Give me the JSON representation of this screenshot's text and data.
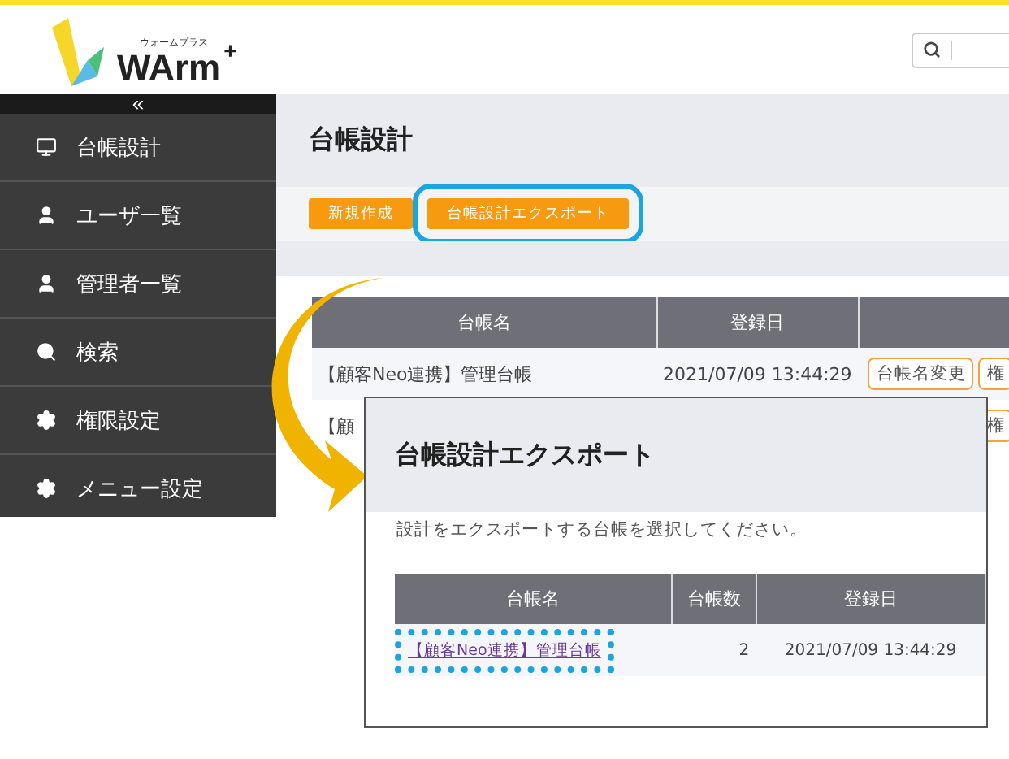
{
  "logo": {
    "kana": "ウォームプラス",
    "text": "WArm",
    "plus": "+"
  },
  "sidebar": {
    "collapse": "«",
    "items": [
      {
        "label": "台帳設計"
      },
      {
        "label": "ユーザ一覧"
      },
      {
        "label": "管理者一覧"
      },
      {
        "label": "検索"
      },
      {
        "label": "権限設定"
      },
      {
        "label": "メニュー設定"
      }
    ]
  },
  "page": {
    "title": "台帳設計",
    "buttons": [
      {
        "label": "新規作成",
        "highlighted": false
      },
      {
        "label": "台帳設計エクスポート",
        "highlighted": true
      }
    ]
  },
  "table": {
    "columns": [
      "台帳名",
      "登録日"
    ],
    "rows": [
      {
        "name": "【顧客Neo連携】管理台帳",
        "date": "2021/07/09 13:44:29",
        "actions": [
          "台帳名変更",
          "権"
        ]
      },
      {
        "name": "【顧",
        "date": "",
        "actions": [
          "権"
        ]
      }
    ]
  },
  "dialog": {
    "title": "台帳設計エクスポート",
    "instruction": "設計をエクスポートする台帳を選択してください。",
    "columns": [
      "台帳名",
      "台帳数",
      "登録日"
    ],
    "rows": [
      {
        "name": "【顧客Neo連携】管理台帳",
        "count": "2",
        "date": "2021/07/09 13:44:29",
        "highlighted": true
      }
    ]
  }
}
